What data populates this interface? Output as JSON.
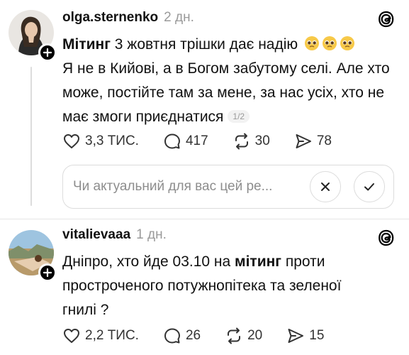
{
  "posts": [
    {
      "username": "olga.sternenko",
      "time": "2 дн.",
      "keyword": "Мітинг",
      "text_line1_rest": " 3 жовтня трішки дає надію",
      "text_rest": "Я не в Кийові, а в Богом забутому селі. Але хто може, постійте там за мене, за нас усіх, хто не має змоги приєднатися",
      "page_count": "1/2",
      "likes": "3,3 ТИС.",
      "comments": "417",
      "reposts": "30",
      "shares": "78",
      "emoji": "pleading-face-emoji"
    },
    {
      "username": "vitalievaaa",
      "time": "1 дн.",
      "text_before": "Дніпро, хто йде 03.10 на ",
      "keyword": "мітинг",
      "text_after": " проти простроченого потужнопітека та зеленої гнилі ?",
      "likes": "2,2 ТИС.",
      "comments": "26",
      "reposts": "20",
      "shares": "15"
    }
  ],
  "feedback": {
    "question": "Чи актуальний для вас цей ре..."
  },
  "icons": [
    "heart-icon",
    "comment-icon",
    "repost-icon",
    "share-icon",
    "threads-logo-icon",
    "plus-icon",
    "close-icon",
    "check-icon"
  ]
}
